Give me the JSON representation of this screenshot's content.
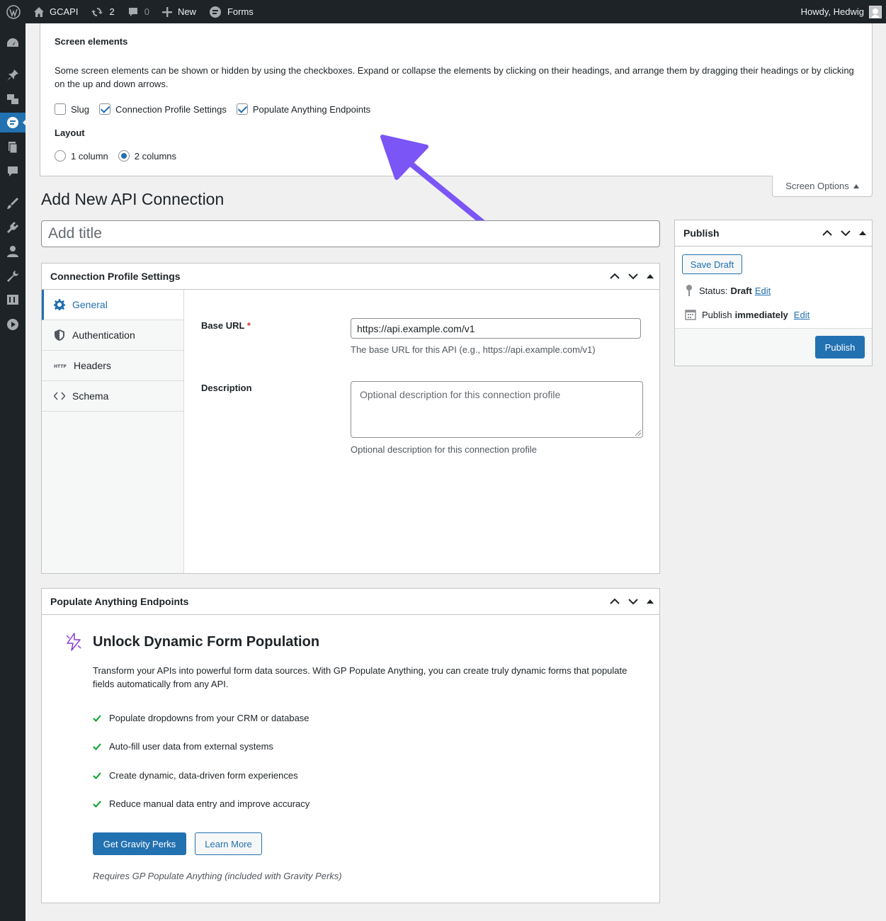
{
  "adminbar": {
    "site_name": "GCAPI",
    "updates_count": "2",
    "comments_count": "0",
    "new_label": "New",
    "forms_label": "Forms",
    "greeting": "Howdy, Hedwig"
  },
  "screen_options": {
    "heading": "Screen elements",
    "description": "Some screen elements can be shown or hidden by using the checkboxes. Expand or collapse the elements by clicking on their headings, and arrange them by dragging their headings or by clicking on the up and down arrows.",
    "checkboxes": [
      {
        "label": "Slug",
        "checked": false
      },
      {
        "label": "Connection Profile Settings",
        "checked": true
      },
      {
        "label": "Populate Anything Endpoints",
        "checked": true
      }
    ],
    "layout_heading": "Layout",
    "layout_options": [
      {
        "label": "1 column",
        "checked": false
      },
      {
        "label": "2 columns",
        "checked": true
      }
    ],
    "tab_label": "Screen Options"
  },
  "page": {
    "title": "Add New API Connection",
    "title_placeholder": "Add title"
  },
  "connection_profile": {
    "heading": "Connection Profile Settings",
    "tabs": [
      {
        "label": "General",
        "icon": "gear-icon"
      },
      {
        "label": "Authentication",
        "icon": "shield-icon"
      },
      {
        "label": "Headers",
        "icon": "http-icon"
      },
      {
        "label": "Schema",
        "icon": "code-icon"
      }
    ],
    "base_url_label": "Base URL",
    "required_mark": "*",
    "base_url_value": "https://api.example.com/v1",
    "base_url_help": "The base URL for this API (e.g., https://api.example.com/v1)",
    "description_label": "Description",
    "description_placeholder": "Optional description for this connection profile",
    "description_help": "Optional description for this connection profile"
  },
  "populate_anything": {
    "heading": "Populate Anything Endpoints",
    "promo_title": "Unlock Dynamic Form Population",
    "promo_description": "Transform your APIs into powerful form data sources. With GP Populate Anything, you can create truly dynamic forms that populate fields automatically from any API.",
    "features": [
      "Populate dropdowns from your CRM or database",
      "Auto-fill user data from external systems",
      "Create dynamic, data-driven form experiences",
      "Reduce manual data entry and improve accuracy"
    ],
    "primary_button": "Get Gravity Perks",
    "secondary_button": "Learn More",
    "note": "Requires GP Populate Anything (included with Gravity Perks)"
  },
  "publish": {
    "heading": "Publish",
    "save_draft": "Save Draft",
    "status_label": "Status:",
    "status_value": "Draft",
    "status_edit": "Edit",
    "publish_label": "Publish",
    "publish_value": "immediately",
    "publish_edit": "Edit",
    "publish_button": "Publish"
  },
  "colors": {
    "accent": "#2271b1",
    "annotation_arrow": "#7b55f6",
    "check_green": "#00a32a"
  }
}
